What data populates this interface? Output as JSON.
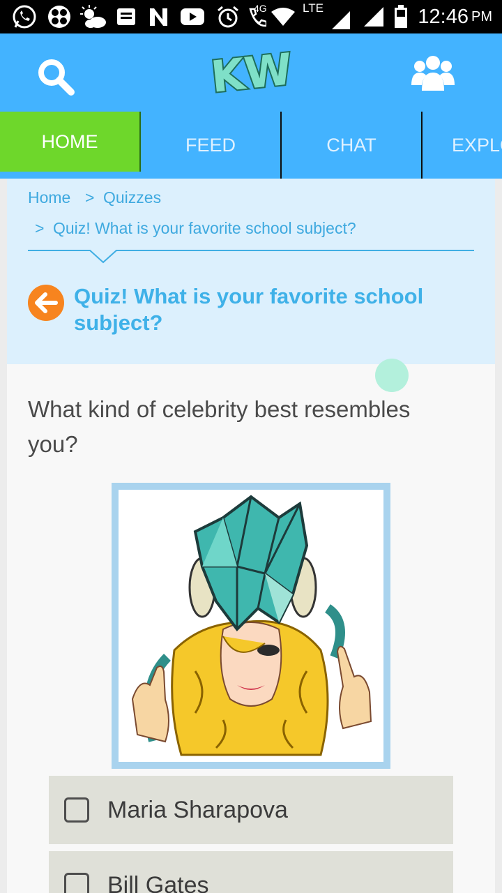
{
  "status_bar": {
    "time": "12:46",
    "ampm": "PM",
    "network_4g": "4G",
    "network_lte": "LTE",
    "icons": [
      "whatsapp-icon",
      "clover-icon",
      "weather-icon",
      "news-icon",
      "n-app-icon",
      "youtube-icon",
      "alarm-icon",
      "call-4g-icon",
      "wifi-icon",
      "signal-icon",
      "signal-icon",
      "battery-icon"
    ]
  },
  "header": {
    "logo_text": "KW",
    "search_icon": "search-icon",
    "people_icon": "people-icon",
    "colors": {
      "background": "#43b3ff",
      "logo_fill": "#7fe0c8"
    }
  },
  "nav": {
    "tabs": [
      {
        "label": "HOME",
        "active": true
      },
      {
        "label": "FEED",
        "active": false
      },
      {
        "label": "CHAT",
        "active": false
      },
      {
        "label": "EXPLO",
        "active": false
      }
    ],
    "active_color": "#6ed72b"
  },
  "breadcrumb": {
    "home": "Home",
    "sep1": ">",
    "quizzes": "Quizzes",
    "sep2": ">",
    "current": "Quiz! What is your favorite school subject?"
  },
  "quiz": {
    "back_icon": "back-arrow-icon",
    "title": "Quiz! What is your favorite school subject?",
    "question": "What kind of celebrity best resembles you?",
    "image_alt": "illustration of a woman with yellow curly hair wearing a teal geometric crystal headpiece",
    "options": [
      {
        "label": "Maria Sharapova",
        "checked": false
      },
      {
        "label": "Bill Gates",
        "checked": false
      }
    ]
  }
}
